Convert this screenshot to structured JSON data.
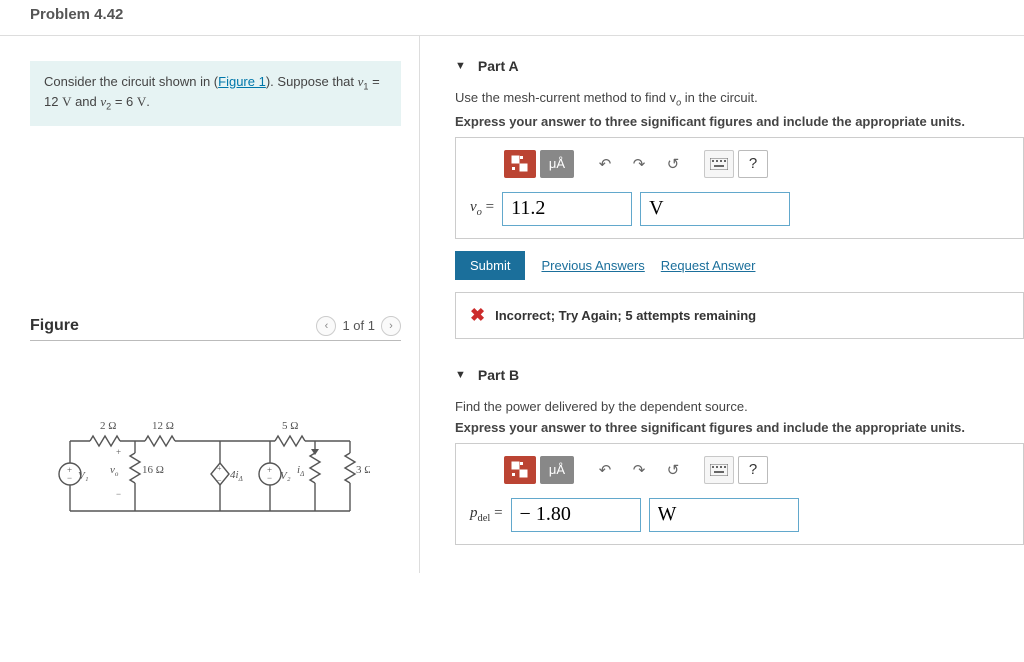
{
  "header": {
    "title": "Problem 4.42"
  },
  "prompt": {
    "pre": "Consider the circuit shown in (",
    "link": "Figure 1",
    "post": "). Suppose that "
  },
  "figure": {
    "heading": "Figure",
    "pager": "1 of 1",
    "labels": {
      "r1": "2 Ω",
      "r2": "12 Ω",
      "r3": "5 Ω",
      "v1": "V₁",
      "vo": "v",
      "vosub": "o",
      "r16": "16 Ω",
      "dep": "4i",
      "depsub": "Δ",
      "v2": "V₂",
      "ia": "i",
      "iasub": "Δ",
      "r3o": "3 Ω",
      "plus": "+",
      "minus": "−"
    }
  },
  "partA": {
    "title": "Part A",
    "instr": "Use the mesh-current method to find v",
    "instrSub": "o",
    "instr2": " in the circuit.",
    "bold": "Express your answer to three significant figures and include the appropriate units.",
    "lhs": "v",
    "lhsSub": "o",
    "eq": " = ",
    "value": "11.2",
    "unit": "V",
    "unitsBtn": "μÅ",
    "submit": "Submit",
    "prev": "Previous Answers",
    "req": "Request Answer",
    "feedback": "Incorrect; Try Again; 5 attempts remaining"
  },
  "partB": {
    "title": "Part B",
    "instr": "Find the power delivered by the dependent source.",
    "bold": "Express your answer to three significant figures and include the appropriate units.",
    "lhs": "p",
    "lhsSub": "del",
    "eq": " = ",
    "value": "− 1.80",
    "unit": "W",
    "unitsBtn": "μÅ"
  },
  "help": "?"
}
